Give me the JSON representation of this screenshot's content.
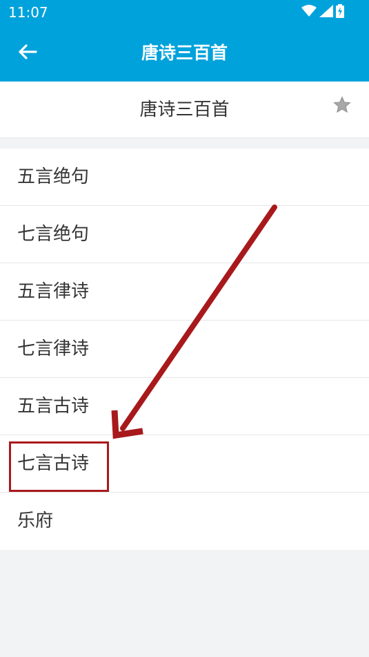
{
  "status_bar": {
    "time": "11:07",
    "icons": [
      "wifi-icon",
      "signal-icon",
      "battery-charging-icon"
    ]
  },
  "app_bar": {
    "title": "唐诗三百首",
    "back_icon": "arrow-left-icon"
  },
  "header": {
    "title": "唐诗三百首",
    "favorite_icon": "star-icon"
  },
  "list": {
    "items": [
      {
        "label": "五言绝句"
      },
      {
        "label": "七言绝句"
      },
      {
        "label": "五言律诗"
      },
      {
        "label": "七言律诗"
      },
      {
        "label": "五言古诗"
      },
      {
        "label": "七言古诗"
      },
      {
        "label": "乐府"
      }
    ]
  },
  "annotation": {
    "highlighted_item": "七言古诗",
    "color": "#a8191c"
  },
  "colors": {
    "app_bar": "#00a2db",
    "background": "#f2f3f5",
    "text": "#333333"
  }
}
